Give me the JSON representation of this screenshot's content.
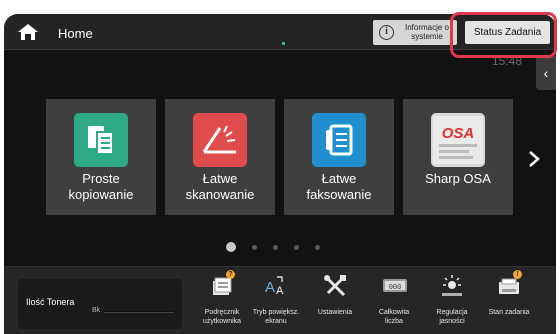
{
  "header": {
    "title": "Home",
    "system_info_label_line1": "Informacje o",
    "system_info_label_line2": "systemie",
    "status_button_label": "Status Zadania",
    "time_text": "15:48"
  },
  "tiles": [
    {
      "line1": "Proste",
      "line2": "kopiowanie",
      "icon": "copy-icon",
      "color": "#2eaa86"
    },
    {
      "line1": "Łatwe",
      "line2": "skanowanie",
      "icon": "scan-icon",
      "color": "#e04b4b"
    },
    {
      "line1": "Łatwe",
      "line2": "faksowanie",
      "icon": "fax-icon",
      "color": "#1f8fd0"
    },
    {
      "line1": "Sharp OSA",
      "line2": "",
      "icon": "sharp-osa-icon",
      "color": "#d9d9d9"
    }
  ],
  "pager": {
    "pages": 5,
    "active": 1
  },
  "bottom": {
    "toner_label": "Ilość Tonera",
    "toner_color_label": "Bk",
    "tools": [
      {
        "line1": "Podręcznik",
        "line2": "użytkownika",
        "icon": "manual-icon"
      },
      {
        "line1": "Tryb powiększ.",
        "line2": "ekranu",
        "icon": "text-enlarge-icon"
      },
      {
        "line1": "Ustawienia",
        "line2": "",
        "icon": "settings-tools-icon"
      },
      {
        "line1": "Całkowita",
        "line2": "liczba",
        "icon": "counter-icon"
      },
      {
        "line1": "Regulacja",
        "line2": "jasności",
        "icon": "brightness-icon"
      },
      {
        "line1": "Stan zadania",
        "line2": "",
        "icon": "job-status-icon"
      }
    ]
  },
  "colors": {
    "highlight": "#e2384d",
    "accent_badge": "#f2a531"
  }
}
